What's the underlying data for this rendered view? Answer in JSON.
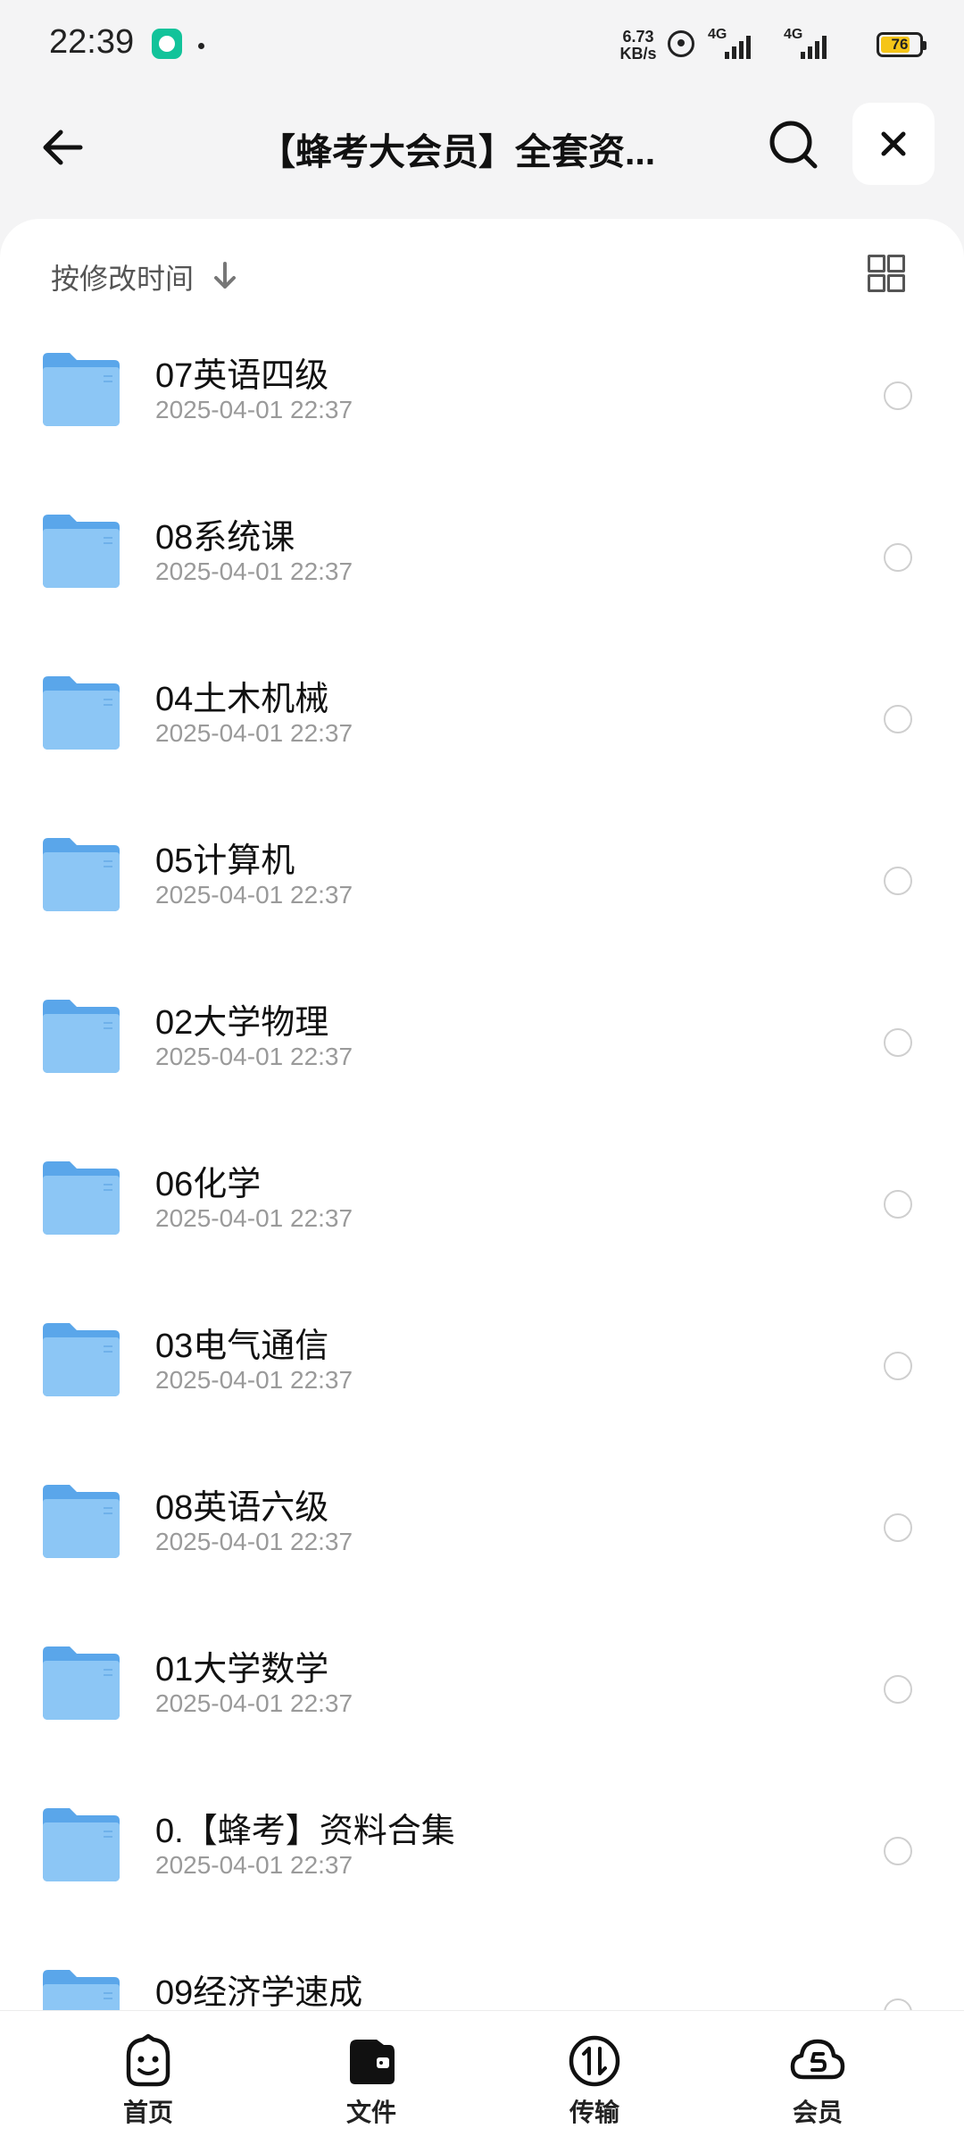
{
  "status_bar": {
    "time": "22:39",
    "net_speed_value": "6.73",
    "net_speed_unit": "KB/s",
    "signal_1_label": "4G",
    "signal_2_label": "4G",
    "battery_level": "76"
  },
  "header": {
    "title": "【蜂考大会员】全套资...",
    "back_icon": "arrow-left-icon",
    "search_icon": "search-icon",
    "close_icon": "close-icon"
  },
  "sort": {
    "label": "按修改时间",
    "direction_icon": "arrow-down-icon",
    "view_toggle_icon": "grid-view-icon"
  },
  "files": [
    {
      "name": "07英语四级",
      "date": "2025-04-01 22:37"
    },
    {
      "name": "08系统课",
      "date": "2025-04-01 22:37"
    },
    {
      "name": "04土木机械",
      "date": "2025-04-01 22:37"
    },
    {
      "name": "05计算机",
      "date": "2025-04-01 22:37"
    },
    {
      "name": "02大学物理",
      "date": "2025-04-01 22:37"
    },
    {
      "name": "06化学",
      "date": "2025-04-01 22:37"
    },
    {
      "name": "03电气通信",
      "date": "2025-04-01 22:37"
    },
    {
      "name": "08英语六级",
      "date": "2025-04-01 22:37"
    },
    {
      "name": "01大学数学",
      "date": "2025-04-01 22:37"
    },
    {
      "name": "0.【蜂考】资料合集",
      "date": "2025-04-01 22:37"
    },
    {
      "name": "09经济学速成",
      "date": ""
    }
  ],
  "bottom_nav": [
    {
      "label": "首页",
      "icon": "smiley-home-icon"
    },
    {
      "label": "文件",
      "icon": "wallet-file-icon"
    },
    {
      "label": "传输",
      "icon": "transfer-icon"
    },
    {
      "label": "会员",
      "icon": "cloud-member-icon"
    }
  ],
  "colors": {
    "folder": "#6db4ef",
    "background": "#f4f4f5",
    "battery": "#f5c518"
  }
}
